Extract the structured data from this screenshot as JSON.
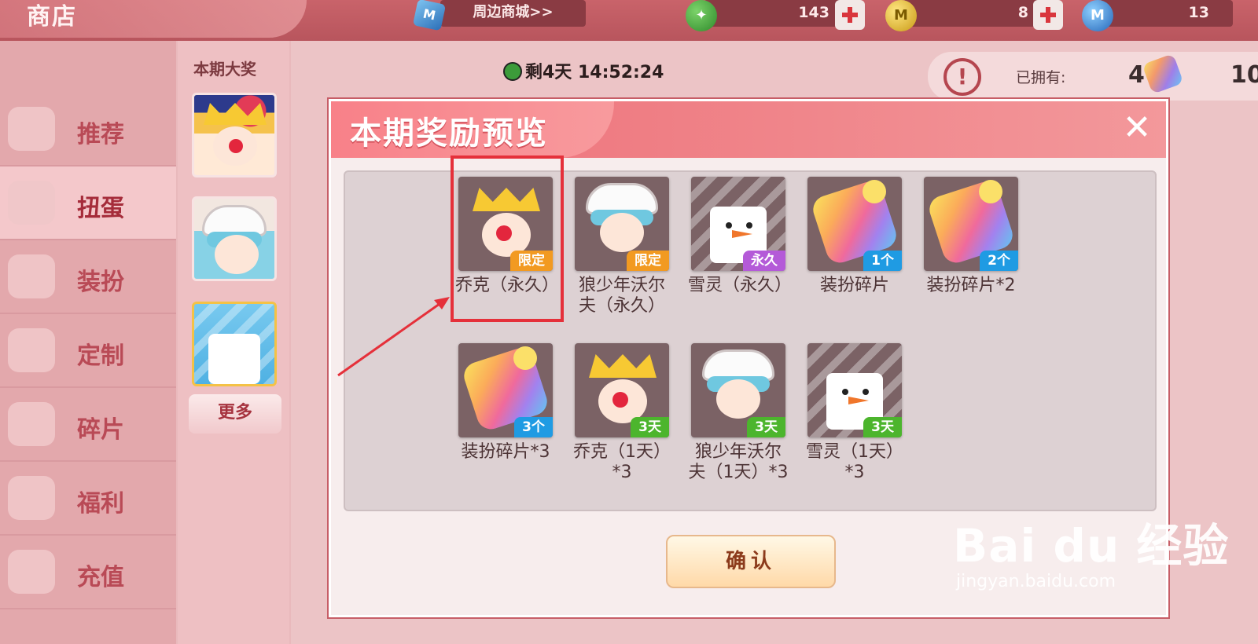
{
  "topbar": {
    "title": "商店",
    "mall_label": "周边商城>>",
    "mall_icon_text": "M",
    "currencies": [
      {
        "icon": "green-coin-icon",
        "value": "143",
        "color": "#2f8a2b"
      },
      {
        "icon": "gold-coin-icon",
        "value": "8",
        "color": "#c99a16"
      },
      {
        "icon": "blue-coin-icon",
        "value": "13",
        "color": "#2566b8"
      }
    ]
  },
  "sidebar": {
    "items": [
      {
        "label": "推荐",
        "icon": "thumbs-up-icon"
      },
      {
        "label": "扭蛋",
        "icon": "capsule-icon",
        "active": true
      },
      {
        "label": "装扮",
        "icon": "shirt-icon"
      },
      {
        "label": "定制",
        "icon": "pencil-icon"
      },
      {
        "label": "碎片",
        "icon": "puzzle-icon"
      },
      {
        "label": "福利",
        "icon": "gift-icon"
      },
      {
        "label": "充值",
        "icon": "coin-stack-icon"
      }
    ]
  },
  "prize_column": {
    "heading": "本期大奖",
    "more_label": "更多"
  },
  "main": {
    "timer": "剩4天 14:52:24",
    "owned_label": "已拥有:",
    "owned_value": "4",
    "owned_value_2": "10"
  },
  "modal": {
    "title": "本期奖励预览",
    "close_glyph": "✕",
    "confirm_label": "确认",
    "rewards": [
      {
        "name": "乔克（永久）",
        "tag": "限定",
        "tag_type": "limited",
        "art": "joker"
      },
      {
        "name": "狼少年沃尔夫（永久）",
        "tag": "限定",
        "tag_type": "limited",
        "art": "wolf"
      },
      {
        "name": "雪灵（永久）",
        "tag": "永久",
        "tag_type": "perm",
        "art": "snow"
      },
      {
        "name": "装扮碎片",
        "tag": "1个",
        "tag_type": "count",
        "art": "piece"
      },
      {
        "name": "装扮碎片*2",
        "tag": "2个",
        "tag_type": "count",
        "art": "piece"
      },
      {
        "name": "装扮碎片*3",
        "tag": "3个",
        "tag_type": "count",
        "art": "piece"
      },
      {
        "name": "乔克（1天）*3",
        "tag": "3天",
        "tag_type": "days",
        "art": "joker"
      },
      {
        "name": "狼少年沃尔夫（1天）*3",
        "tag": "3天",
        "tag_type": "days",
        "art": "wolf"
      },
      {
        "name": "雪灵（1天）*3",
        "tag": "3天",
        "tag_type": "days",
        "art": "snow"
      }
    ]
  },
  "watermark": {
    "main": "Bai du 经验",
    "sub": "jingyan.baidu.com"
  },
  "colors": {
    "accent": "#f06f79",
    "highlight": "#e5303a",
    "tag_limited": "#f29a21",
    "tag_perm": "#b45ad8",
    "tag_count": "#1f9be3",
    "tag_days": "#4cb52d"
  }
}
